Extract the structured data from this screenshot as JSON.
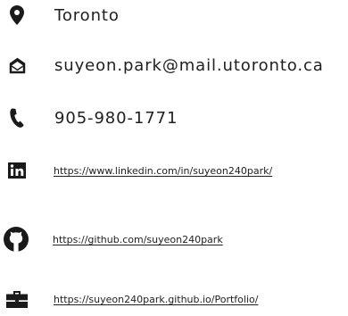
{
  "contacts": {
    "location": {
      "icon": "location-pin-icon",
      "text": "Toronto"
    },
    "email": {
      "icon": "envelope-icon",
      "text": "suyeon.park@mail.utoronto.ca"
    },
    "phone": {
      "icon": "phone-icon",
      "text": "905-980-1771"
    },
    "linkedin": {
      "icon": "linkedin-icon",
      "text": "https://www.linkedin.com/in/suyeon240park/"
    },
    "github": {
      "icon": "github-icon",
      "text": "https://github.com/suyeon240park"
    },
    "portfolio": {
      "icon": "briefcase-icon",
      "text": "https://suyeon240park.github.io/Portfolio/"
    }
  },
  "colors": {
    "text": "#202020",
    "icon": "#1a1a1a"
  }
}
